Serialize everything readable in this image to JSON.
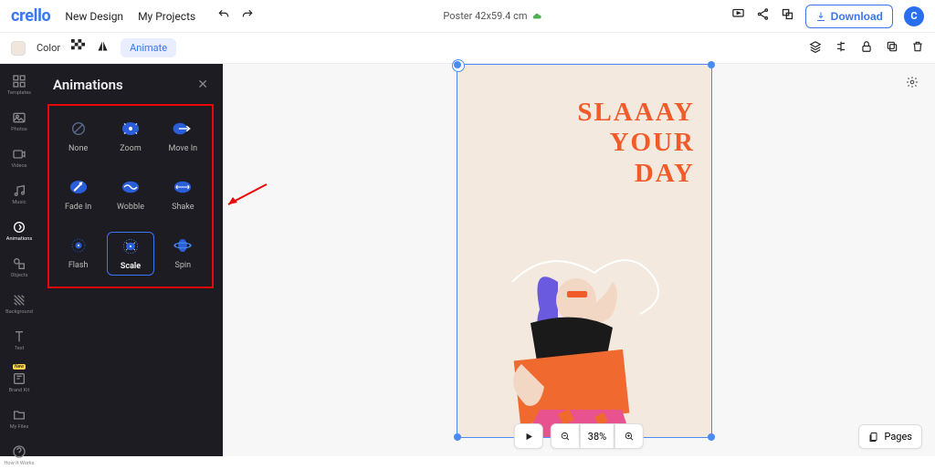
{
  "brand": "crello",
  "top": {
    "new_design": "New Design",
    "my_projects": "My Projects",
    "doc_title": "Poster 42x59.4 cm",
    "download": "Download",
    "avatar_initial": "C"
  },
  "toolbar": {
    "color": "Color",
    "animate": "Animate"
  },
  "rail": [
    {
      "key": "templates",
      "label": "Templates"
    },
    {
      "key": "photos",
      "label": "Photos"
    },
    {
      "key": "videos",
      "label": "Videos"
    },
    {
      "key": "music",
      "label": "Music"
    },
    {
      "key": "animations",
      "label": "Animations"
    },
    {
      "key": "objects",
      "label": "Objects"
    },
    {
      "key": "background",
      "label": "Background"
    },
    {
      "key": "text",
      "label": "Text"
    },
    {
      "key": "brandkit",
      "label": "Brand Kit",
      "badge": "New"
    },
    {
      "key": "myfiles",
      "label": "My Files"
    },
    {
      "key": "howit",
      "label": "How It Works"
    }
  ],
  "panel": {
    "title": "Animations",
    "items": [
      {
        "key": "none",
        "label": "None"
      },
      {
        "key": "zoom",
        "label": "Zoom"
      },
      {
        "key": "movein",
        "label": "Move In"
      },
      {
        "key": "fadein",
        "label": "Fade In"
      },
      {
        "key": "wobble",
        "label": "Wobble"
      },
      {
        "key": "shake",
        "label": "Shake"
      },
      {
        "key": "flash",
        "label": "Flash"
      },
      {
        "key": "scale",
        "label": "Scale"
      },
      {
        "key": "spin",
        "label": "Spin"
      }
    ],
    "selected": "scale"
  },
  "poster": {
    "line1": "SLAAAY",
    "line2": "YOUR",
    "line3": "DAY"
  },
  "bottom": {
    "zoom_pct": "38%",
    "pages": "Pages"
  }
}
